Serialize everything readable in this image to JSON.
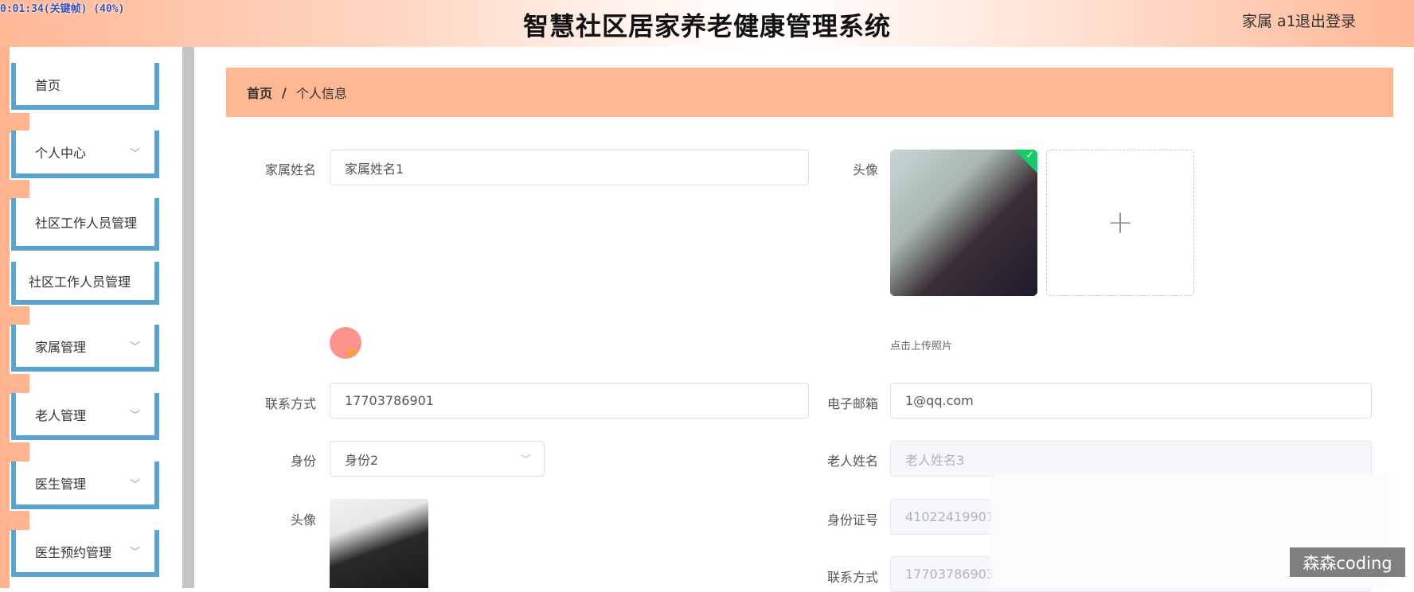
{
  "overlay": {
    "timestamp": "0:01:34(关键帧) (40%)",
    "watermark": "森森coding"
  },
  "header": {
    "title": "智慧社区居家养老健康管理系统",
    "user": "家属 a1",
    "logout": "退出登录"
  },
  "sidebar": {
    "items": [
      {
        "label": "首页"
      },
      {
        "label": "个人中心",
        "chevron": "﹀"
      },
      {
        "label": "社区工作人员管理"
      },
      {
        "label": "社区工作人员管理"
      },
      {
        "label": "家属管理",
        "chevron": "﹀"
      },
      {
        "label": "老人管理",
        "chevron": "﹀"
      },
      {
        "label": "医生管理",
        "chevron": "﹀"
      },
      {
        "label": "医生预约管理",
        "chevron": "﹀"
      }
    ]
  },
  "breadcrumb": {
    "home": "首页",
    "sep": "/",
    "current": "个人信息"
  },
  "form": {
    "name": {
      "label": "家属姓名",
      "value": "家属姓名1"
    },
    "avatar": {
      "label": "头像",
      "plus": "+",
      "hint": "点击上传照片",
      "check": "✓"
    },
    "phone": {
      "label": "联系方式",
      "value": "17703786901"
    },
    "email": {
      "label": "电子邮箱",
      "value": "1@qq.com"
    },
    "identity": {
      "label": "身份",
      "value": "身份2",
      "chevron": "﹀"
    },
    "elder_name": {
      "label": "老人姓名",
      "value": "老人姓名3"
    },
    "elder_avatar": {
      "label": "头像"
    },
    "elder_id": {
      "label": "身份证号",
      "value": "41022419901"
    },
    "elder_phone": {
      "label": "联系方式",
      "value": "17703786903"
    }
  },
  "colors": {
    "accent": "#ffb894",
    "nav_border": "#5aa5cf",
    "success": "#13ce66"
  }
}
